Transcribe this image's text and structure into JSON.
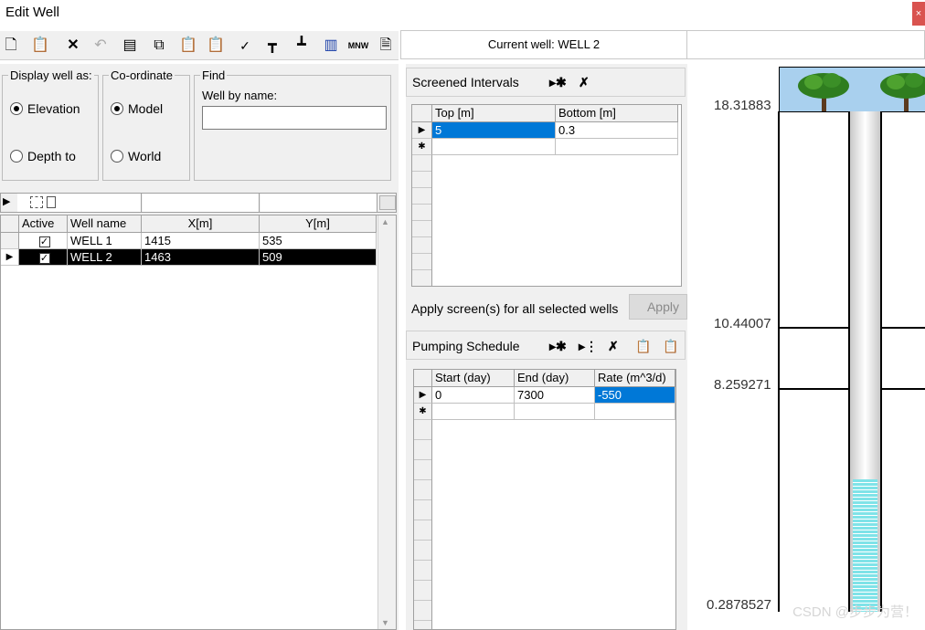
{
  "window": {
    "title": "Edit Well",
    "close_glyph": "×"
  },
  "current_well": "Current well: WELL 2",
  "display_group": {
    "legend": "Display well as:",
    "option1": "Elevation",
    "option2": "Depth to"
  },
  "coord_group": {
    "legend": "Co-ordinate",
    "option1": "Model",
    "option2": "World"
  },
  "find_group": {
    "legend": "Find",
    "label": "Well by name:",
    "value": ""
  },
  "wells_table": {
    "headers": [
      "Active",
      "Well name",
      "X[m]",
      "Y[m]"
    ],
    "rows": [
      {
        "name": "WELL 1",
        "x": "1415",
        "y": "535"
      },
      {
        "name": "WELL 2",
        "x": "1463",
        "y": "509"
      }
    ]
  },
  "screened": {
    "title": "Screened Intervals",
    "headers": [
      "Top [m]",
      "Bottom [m]"
    ],
    "rows": [
      {
        "top": "5",
        "bottom": "0.3"
      }
    ],
    "apply_label": "Apply screen(s) for all selected wells",
    "apply_button": "Apply"
  },
  "pumping": {
    "title": "Pumping Schedule",
    "headers": [
      "Start (day)",
      "End (day)",
      "Rate (m^3/d)"
    ],
    "rows": [
      {
        "start": "0",
        "end": "7300",
        "rate": "-550"
      }
    ]
  },
  "well_view": {
    "labels": [
      "18.31883",
      "10.44007",
      "8.259271",
      "0.2878527"
    ]
  },
  "watermark": "CSDN @步步为营！",
  "colors": {
    "selection": "#0078d7",
    "sky": "#a9d0ee",
    "water": "#7fe3e8"
  }
}
